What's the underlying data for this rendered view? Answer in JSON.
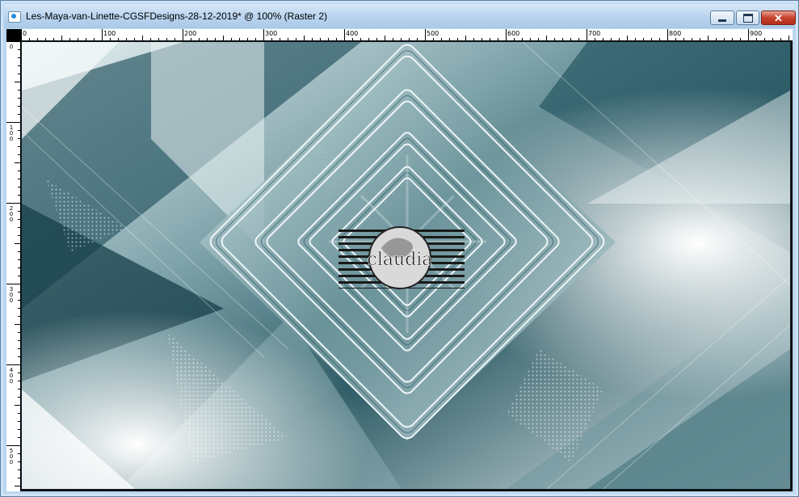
{
  "window": {
    "title": "Les-Maya-van-Linette-CGSFDesigns-28-12-2019* @ 100% (Raster 2)",
    "buttons": {
      "minimize": "minimize-icon",
      "maximize": "maximize-icon",
      "close": "close-icon"
    }
  },
  "rulers": {
    "top_labels": [
      "0",
      "100",
      "200",
      "300",
      "400",
      "500",
      "600",
      "700",
      "800",
      "900"
    ],
    "left_labels": [
      "0",
      "100",
      "200",
      "300",
      "400",
      "500"
    ]
  },
  "watermark": {
    "text": "claudia"
  },
  "colors": {
    "titlebar": "#b8d3ee",
    "close_button": "#c7412d",
    "dark_teal": "#1d4a55",
    "mid_teal": "#5f8c95",
    "light_teal": "#c7dde0"
  }
}
